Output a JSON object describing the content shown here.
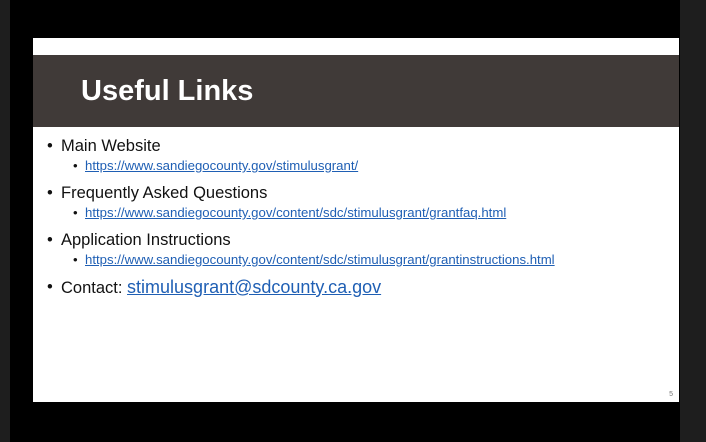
{
  "slide": {
    "title": "Useful Links",
    "items": [
      {
        "label": "Main Website",
        "link": "https://www.sandiegocounty.gov/stimulusgrant/"
      },
      {
        "label": "Frequently Asked Questions",
        "link": "https://www.sandiegocounty.gov/content/sdc/stimulusgrant/grantfaq.html"
      },
      {
        "label": "Application Instructions",
        "link": "https://www.sandiegocounty.gov/content/sdc/stimulusgrant/grantinstructions.html"
      }
    ],
    "contact_label": "Contact:",
    "contact_email": "stimulusgrant@sdcounty.ca.gov",
    "bullet": "•",
    "page_number": "5"
  },
  "colors": {
    "title_bar": "#403a38",
    "link": "#1f5fb4"
  }
}
